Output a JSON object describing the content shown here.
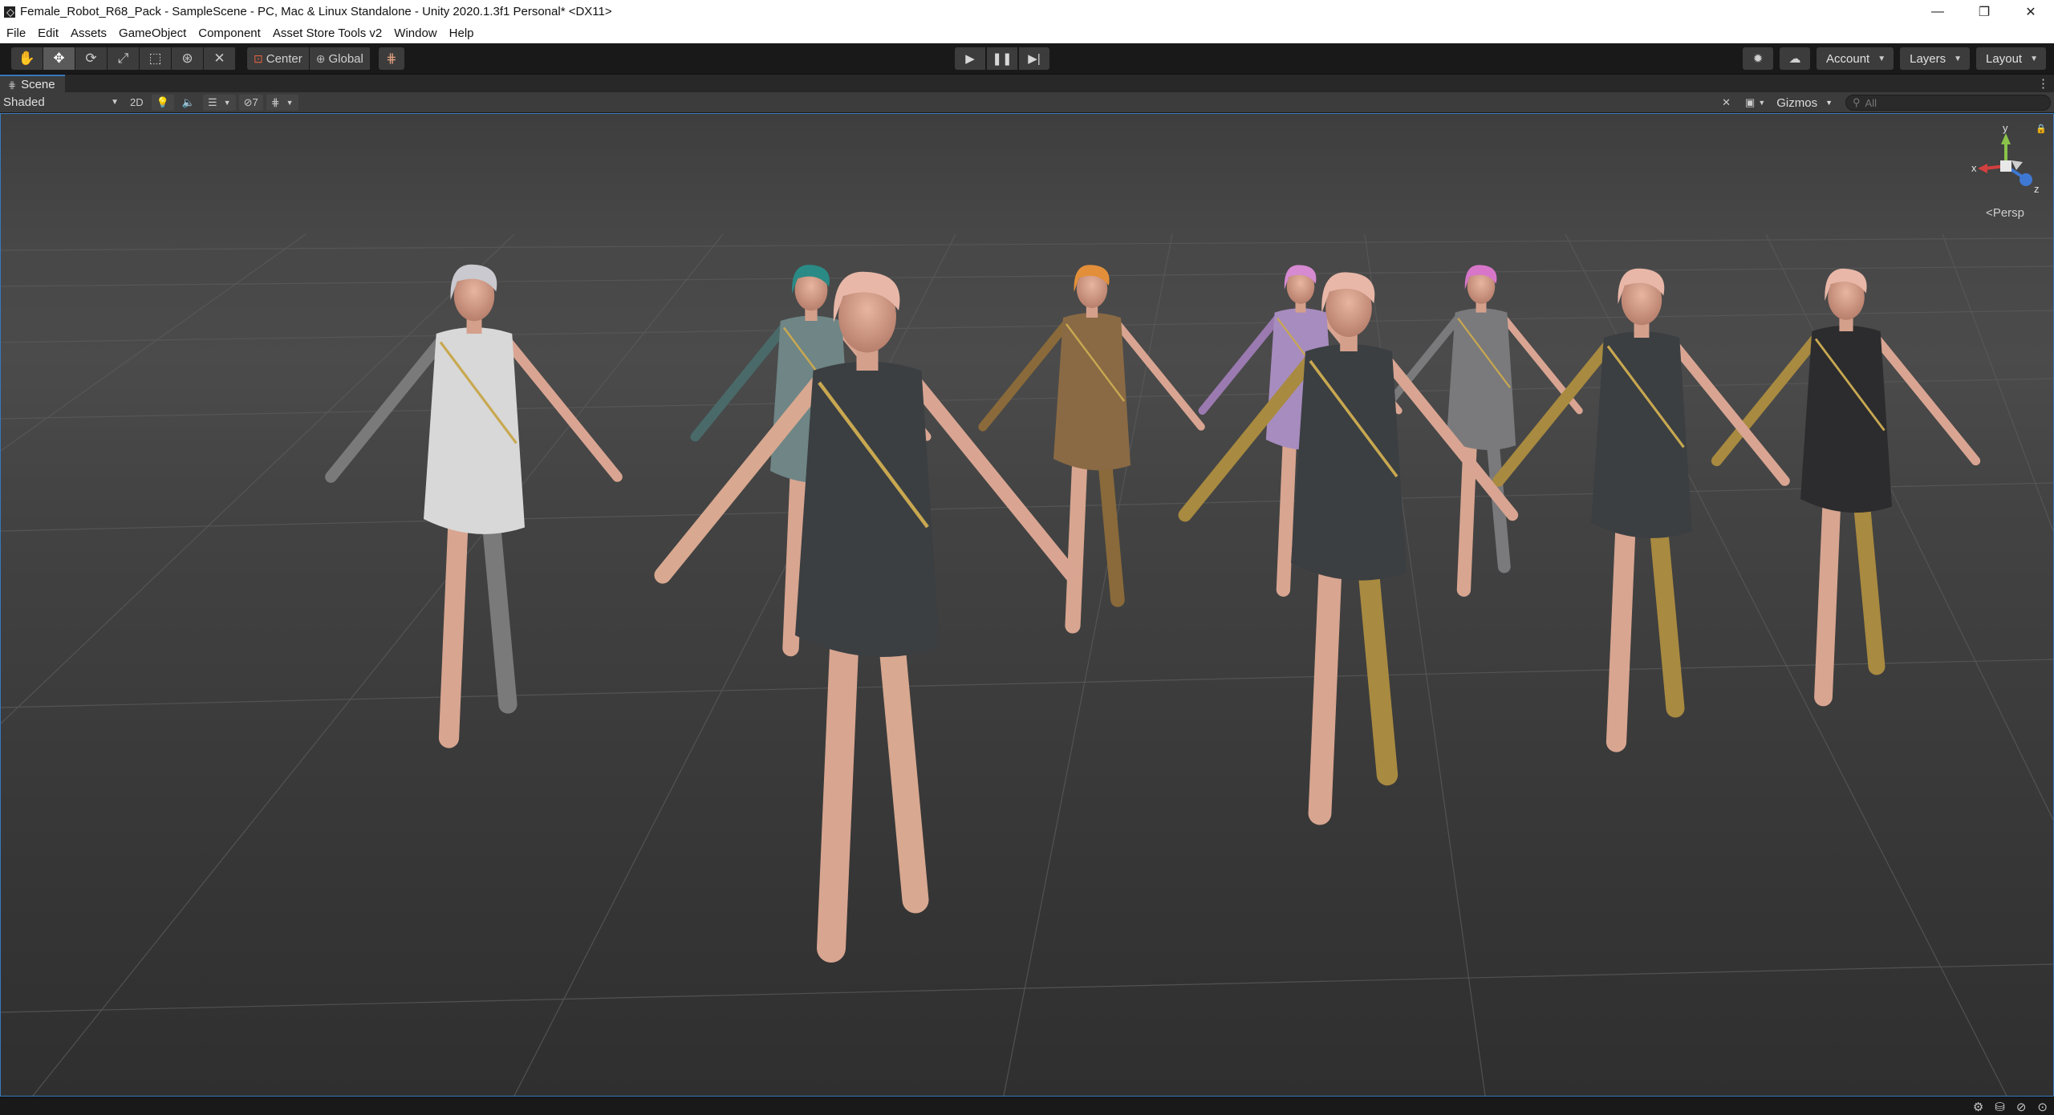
{
  "window": {
    "title": "Female_Robot_R68_Pack - SampleScene - PC, Mac & Linux Standalone - Unity 2020.1.3f1 Personal* <DX11>",
    "controls": {
      "minimize": "—",
      "restore": "❐",
      "close": "✕"
    }
  },
  "menu": [
    "File",
    "Edit",
    "Assets",
    "GameObject",
    "Component",
    "Asset Store Tools v2",
    "Window",
    "Help"
  ],
  "toolbar": {
    "tools": [
      {
        "name": "hand-tool-icon",
        "glyph": "✋"
      },
      {
        "name": "move-tool-icon",
        "glyph": "✥",
        "active": true
      },
      {
        "name": "rotate-tool-icon",
        "glyph": "⟳"
      },
      {
        "name": "scale-tool-icon",
        "glyph": "⤢"
      },
      {
        "name": "rect-tool-icon",
        "glyph": "⬚"
      },
      {
        "name": "transform-tool-icon",
        "glyph": "⊛"
      },
      {
        "name": "custom-tool-icon",
        "glyph": "✕"
      }
    ],
    "pivot_mode": "Center",
    "pivot_rotation": "Global",
    "snap_glyph": "⋕",
    "play": "▶",
    "pause": "❚❚",
    "step": "▶|",
    "collab_glyph": "✹",
    "cloud_glyph": "☁",
    "account": "Account",
    "layers": "Layers",
    "layout": "Layout"
  },
  "scene_tab": {
    "label": "Scene",
    "grid_glyph": "⋕",
    "menu_glyph": "⋮"
  },
  "scene_toolbar": {
    "shading": "Shaded",
    "mode_2d": "2D",
    "light_glyph": "💡",
    "audio_glyph": "🔈",
    "effects_glyph": "☰",
    "hidden_count": "7",
    "grid_glyph": "⋕",
    "tools_glyph": "✕",
    "camera_glyph": "▣",
    "gizmos": "Gizmos",
    "search_placeholder": "All"
  },
  "viewport": {
    "persp": "Persp",
    "axis_x": "x",
    "axis_y": "y",
    "axis_z": "z",
    "characters": [
      {
        "hair": "#c9c9cf",
        "dress": "#d8d8d8",
        "trim": "#c8a850",
        "arm": "#7a7a7a"
      },
      {
        "hair": "#2a8a86",
        "dress": "#6f8586",
        "trim": "#c8a850",
        "arm": "#4a6a6a"
      },
      {
        "hair": "#e8b7a8",
        "dress": "#3b3f42",
        "trim": "#c8a850",
        "arm": "#d8a890"
      },
      {
        "hair": "#e38f3a",
        "dress": "#8a6a44",
        "trim": "#c8a850",
        "arm": "#8a6a3a"
      },
      {
        "hair": "#d58ad1",
        "dress": "#a78cbf",
        "trim": "#c8a850",
        "arm": "#9a7ab0"
      },
      {
        "hair": "#e8b7a8",
        "dress": "#3b3f42",
        "trim": "#c8a850",
        "arm": "#a88a40"
      },
      {
        "hair": "#d776c9",
        "dress": "#7a7a7c",
        "trim": "#c8a850",
        "arm": "#7a7a7c"
      },
      {
        "hair": "#e8b7a8",
        "dress": "#3b3f42",
        "trim": "#c8a850",
        "arm": "#a88a40"
      },
      {
        "hair": "#e8b7a8",
        "dress": "#2c2c2e",
        "trim": "#c8a850",
        "arm": "#a88a40"
      }
    ]
  },
  "status_bar": {
    "icons": [
      "⚙",
      "⛁",
      "⊘",
      "⊙"
    ]
  },
  "colors": {
    "accent": "#3a79bb",
    "toolbar_bg": "#191919",
    "panel_bg": "#3c3c3c"
  }
}
